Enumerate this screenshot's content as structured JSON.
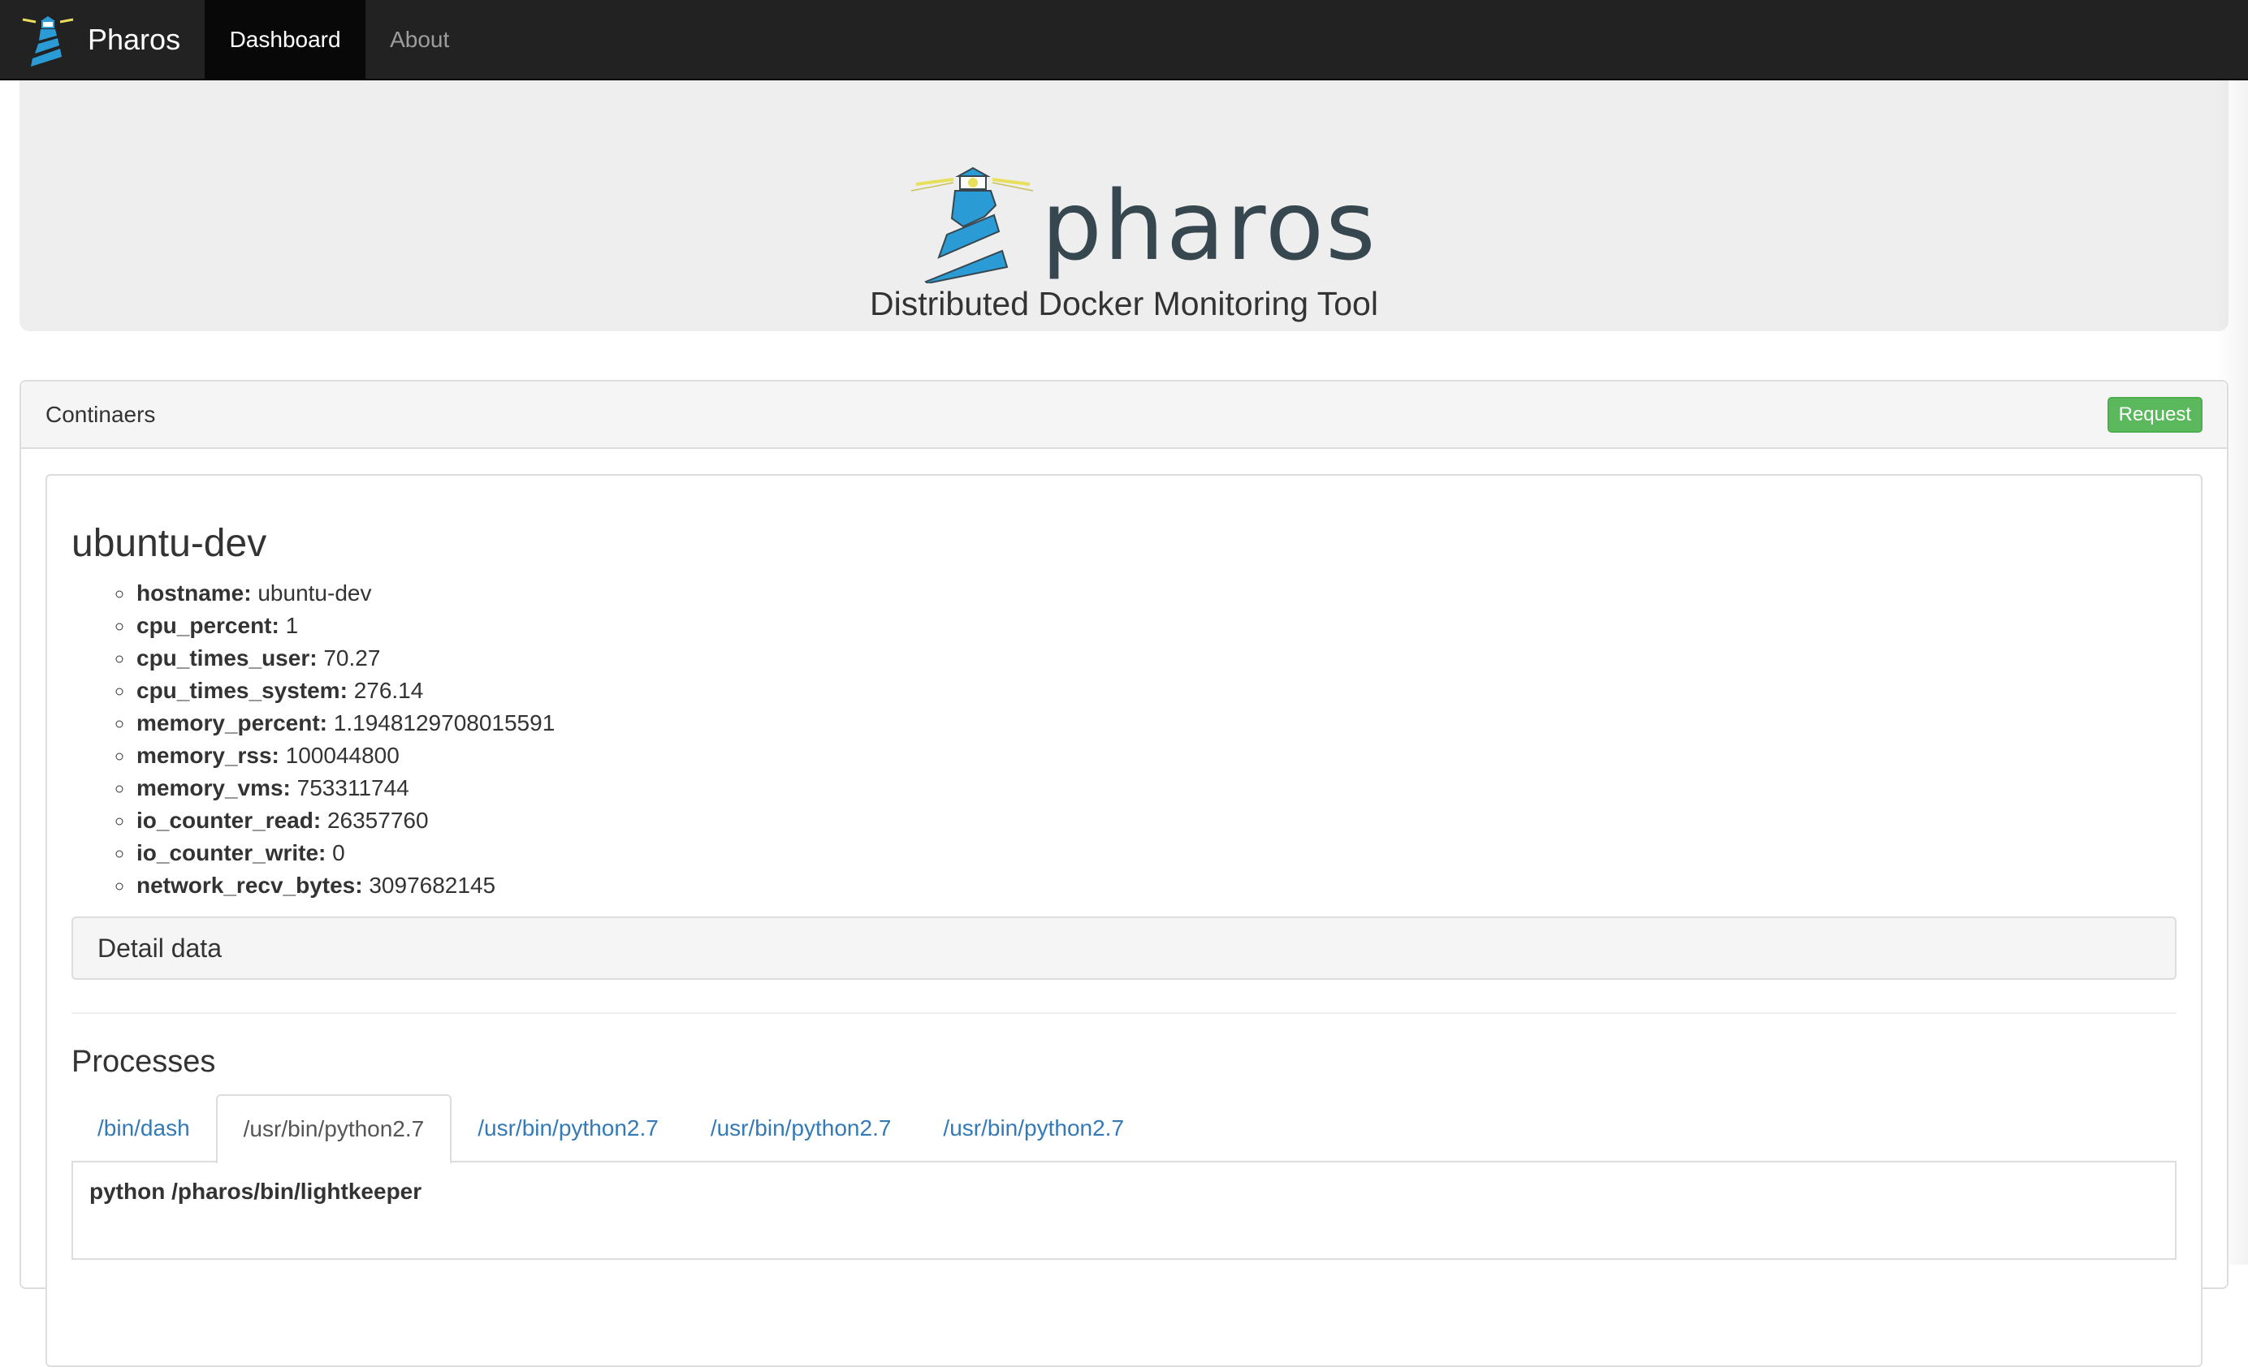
{
  "navbar": {
    "brand": "Pharos",
    "items": [
      {
        "label": "Dashboard",
        "active": true
      },
      {
        "label": "About",
        "active": false
      }
    ]
  },
  "hero": {
    "logo_text": "pharos",
    "subtitle": "Distributed Docker Monitoring Tool"
  },
  "panel": {
    "title": "Continaers",
    "request_label": "Request"
  },
  "container": {
    "name": "ubuntu-dev",
    "stats": [
      {
        "key": "hostname:",
        "value": "ubuntu-dev"
      },
      {
        "key": "cpu_percent:",
        "value": "1"
      },
      {
        "key": "cpu_times_user:",
        "value": "70.27"
      },
      {
        "key": "cpu_times_system:",
        "value": "276.14"
      },
      {
        "key": "memory_percent:",
        "value": "1.1948129708015591"
      },
      {
        "key": "memory_rss:",
        "value": "100044800"
      },
      {
        "key": "memory_vms:",
        "value": "753311744"
      },
      {
        "key": "io_counter_read:",
        "value": "26357760"
      },
      {
        "key": "io_counter_write:",
        "value": "0"
      },
      {
        "key": "network_recv_bytes:",
        "value": "3097682145"
      }
    ],
    "detail_label": "Detail data",
    "processes_title": "Processes",
    "tabs": [
      {
        "label": "/bin/dash",
        "active": false
      },
      {
        "label": "/usr/bin/python2.7",
        "active": true
      },
      {
        "label": "/usr/bin/python2.7",
        "active": false
      },
      {
        "label": "/usr/bin/python2.7",
        "active": false
      },
      {
        "label": "/usr/bin/python2.7",
        "active": false
      }
    ],
    "active_cmdline": "python /pharos/bin/lightkeeper"
  },
  "colors": {
    "navbar_bg": "#222222",
    "accent_link": "#337ab7",
    "success": "#5cb85c",
    "logo_blue": "#2b9bd6",
    "logo_dark": "#37474f",
    "logo_yellow": "#e8e05a"
  }
}
